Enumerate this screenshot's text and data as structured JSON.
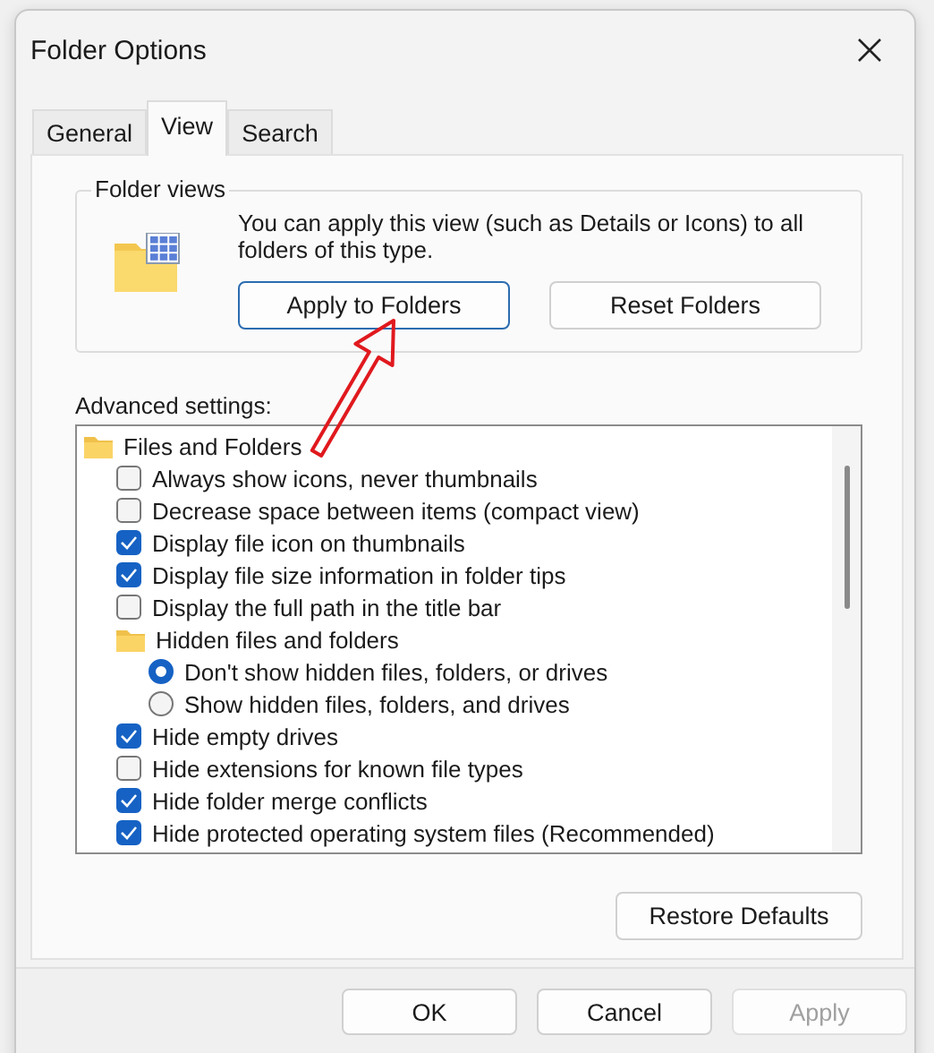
{
  "window": {
    "title": "Folder Options"
  },
  "tabs": [
    {
      "label": "General",
      "selected": false
    },
    {
      "label": "View",
      "selected": true
    },
    {
      "label": "Search",
      "selected": false
    }
  ],
  "folder_views": {
    "title": "Folder views",
    "description": "You can apply this view (such as Details or Icons) to all folders of this type.",
    "buttons": [
      {
        "label": "Apply to Folders",
        "focused": true
      },
      {
        "label": "Reset Folders",
        "focused": false
      }
    ]
  },
  "advanced_settings": {
    "label": "Advanced settings:",
    "items": [
      {
        "kind": "group",
        "label": "Files and Folders",
        "children": [
          {
            "kind": "checkbox",
            "label": "Always show icons, never thumbnails",
            "checked": false
          },
          {
            "kind": "checkbox",
            "label": "Decrease space between items (compact view)",
            "checked": false
          },
          {
            "kind": "checkbox",
            "label": "Display file icon on thumbnails",
            "checked": true
          },
          {
            "kind": "checkbox",
            "label": "Display file size information in folder tips",
            "checked": true
          },
          {
            "kind": "checkbox",
            "label": "Display the full path in the title bar",
            "checked": false
          },
          {
            "kind": "group",
            "label": "Hidden files and folders",
            "children": [
              {
                "kind": "radio",
                "label": "Don't show hidden files, folders, or drives",
                "selected": true
              },
              {
                "kind": "radio",
                "label": "Show hidden files, folders, and drives",
                "selected": false
              }
            ]
          },
          {
            "kind": "checkbox",
            "label": "Hide empty drives",
            "checked": true
          },
          {
            "kind": "checkbox",
            "label": "Hide extensions for known file types",
            "checked": false
          },
          {
            "kind": "checkbox",
            "label": "Hide folder merge conflicts",
            "checked": true
          },
          {
            "kind": "checkbox",
            "label": "Hide protected operating system files (Recommended)",
            "checked": true
          }
        ]
      }
    ],
    "restore_button": "Restore Defaults"
  },
  "buttons": [
    {
      "label": "OK",
      "disabled": false
    },
    {
      "label": "Cancel",
      "disabled": false
    },
    {
      "label": "Apply",
      "disabled": true
    }
  ]
}
